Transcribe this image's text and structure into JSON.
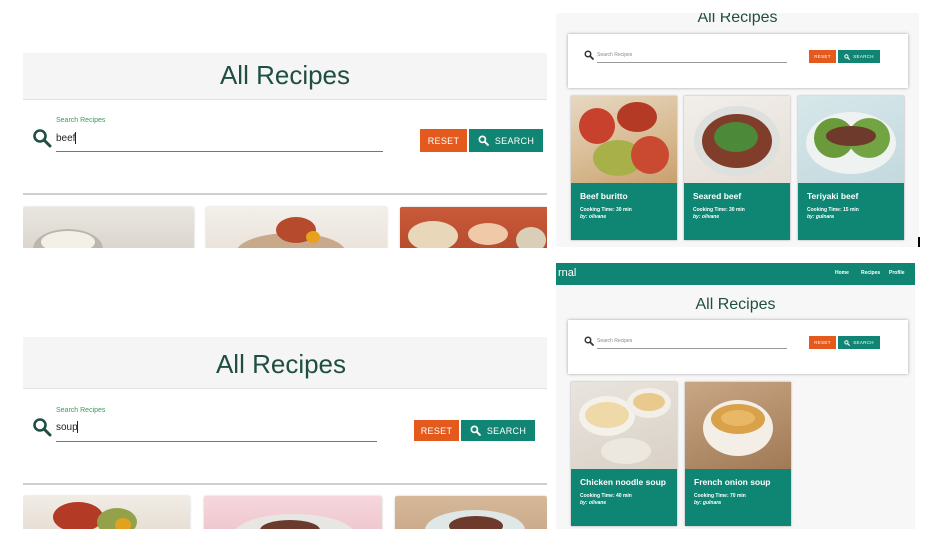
{
  "colors": {
    "teal": "#118574",
    "orange": "#e35a1c",
    "title": "#1f4f43",
    "label_green": "#3a9a5a"
  },
  "icons": {
    "search": "search-icon"
  },
  "panel_a": {
    "title": "All Recipes",
    "search_label": "Search Recipes",
    "search_value": "beef",
    "reset_label": "RESET",
    "search_label_btn": "SEARCH"
  },
  "panel_b": {
    "title": "All Recipes",
    "search_placeholder": "Search Recipes",
    "reset_label": "RESET",
    "search_label_btn": "SEARCH",
    "cards": [
      {
        "name": "Beef buritto",
        "time": "Cooking Time: 30 min",
        "by": "by: olivane"
      },
      {
        "name": "Seared beef",
        "time": "Cooking Time: 30 min",
        "by": "by: olivane"
      },
      {
        "name": "Teriyaki beef",
        "time": "Cooking Time: 15 min",
        "by": "by: gulnara"
      }
    ]
  },
  "panel_c": {
    "title": "All Recipes",
    "search_label": "Search Recipes",
    "search_value": "soup",
    "reset_label": "RESET",
    "search_label_btn": "SEARCH"
  },
  "panel_d": {
    "brand": "rnal",
    "nav": [
      "Home",
      "Recipes",
      "Profile"
    ],
    "title": "All Recipes",
    "search_placeholder": "Search Recipes",
    "reset_label": "RESET",
    "search_label_btn": "SEARCH",
    "cards": [
      {
        "name": "Chicken noodle soup",
        "time": "Cooking Time: 40 min",
        "by": "by: olivane"
      },
      {
        "name": "French onion soup",
        "time": "Cooking Time: 70 min",
        "by": "by: gulnara"
      }
    ]
  }
}
